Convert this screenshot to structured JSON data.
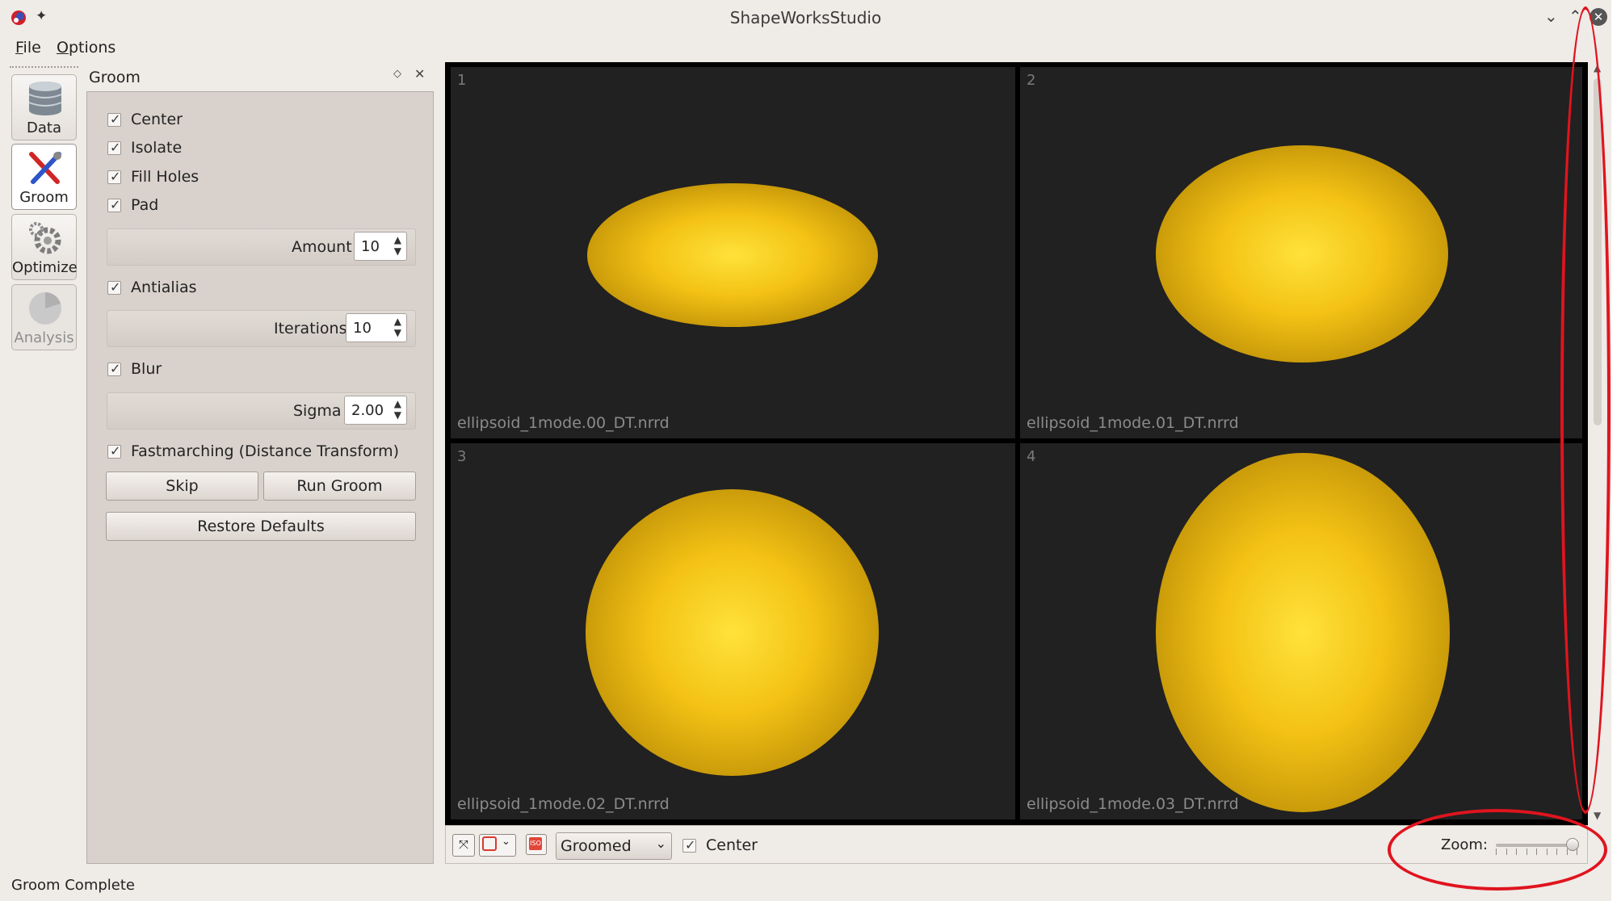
{
  "window": {
    "title": "ShapeWorksStudio"
  },
  "menu": {
    "file": "File",
    "options": "Options"
  },
  "tools": [
    {
      "label": "Data",
      "icon": "database-icon"
    },
    {
      "label": "Groom",
      "icon": "groom-tools-icon"
    },
    {
      "label": "Optimize",
      "icon": "gears-icon"
    },
    {
      "label": "Analysis",
      "icon": "pie-chart-icon"
    }
  ],
  "groom": {
    "title": "Groom",
    "center": "Center",
    "isolate": "Isolate",
    "fill_holes": "Fill Holes",
    "pad": "Pad",
    "amount_label": "Amount",
    "amount_value": "10",
    "antialias": "Antialias",
    "iterations_label": "Iterations",
    "iterations_value": "10",
    "blur": "Blur",
    "sigma_label": "Sigma",
    "sigma_value": "2.00",
    "fastmarching": "Fastmarching (Distance Transform)",
    "skip": "Skip",
    "run_groom": "Run Groom",
    "restore_defaults": "Restore Defaults"
  },
  "viewer": {
    "cells": [
      {
        "number": "1",
        "file": "ellipsoid_1mode.00_DT.nrrd"
      },
      {
        "number": "2",
        "file": "ellipsoid_1mode.01_DT.nrrd"
      },
      {
        "number": "3",
        "file": "ellipsoid_1mode.02_DT.nrrd"
      },
      {
        "number": "4",
        "file": "ellipsoid_1mode.03_DT.nrrd"
      }
    ],
    "shape_color": "#f5c518"
  },
  "bottom": {
    "mode": "Groomed",
    "center": "Center",
    "zoom_label": "Zoom:",
    "zoom_level": 0.95
  },
  "status": {
    "text": "Groom Complete"
  },
  "colors": {
    "annotation_red": "#e0141e"
  }
}
